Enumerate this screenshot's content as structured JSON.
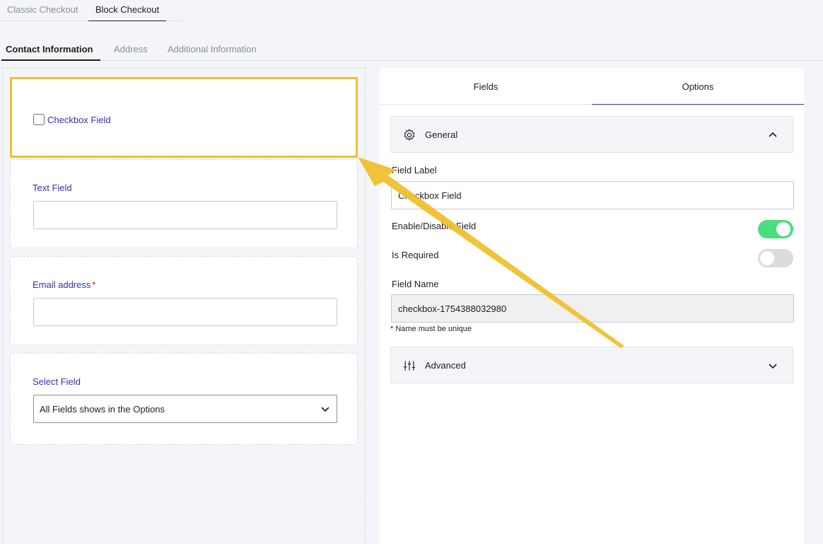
{
  "top_tabs": {
    "classic": "Classic Checkout",
    "block": "Block Checkout"
  },
  "section_tabs": {
    "contact": "Contact Information",
    "address": "Address",
    "additional": "Additional Information"
  },
  "fields": {
    "checkbox_label": "Checkbox Field",
    "text_label": "Text Field",
    "email_label": "Email address",
    "email_required_mark": "*",
    "select_label": "Select Field",
    "select_value": "All Fields shows in the Options"
  },
  "panel": {
    "tab_fields": "Fields",
    "tab_options": "Options",
    "general_title": "General",
    "field_label_label": "Field Label",
    "field_label_value": "Checkbox Field",
    "enable_label": "Enable/Disable Field",
    "enable_on": true,
    "required_label": "Is Required",
    "required_on": false,
    "field_name_label": "Field Name",
    "field_name_value": "checkbox-1754388032980",
    "field_name_hint": "* Name must be unique",
    "advanced_title": "Advanced"
  },
  "icons": {
    "general": "gear-icon",
    "advanced": "sliders-icon",
    "collapse": "chevron-up-icon",
    "expand": "chevron-down-icon",
    "select": "chevron-down-icon"
  },
  "colors": {
    "accent": "#3a2fa8",
    "highlight": "#f0c030",
    "toggle_on": "#4ade80",
    "required": "#cc1818"
  }
}
